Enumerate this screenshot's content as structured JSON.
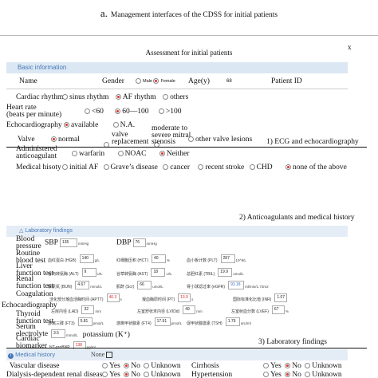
{
  "figure_title": {
    "letter": "a.",
    "text": "Management interfaces of the CDSS for initial patients"
  },
  "dialog": {
    "title": "Assessment for initial patients",
    "close": "x"
  },
  "basic": {
    "title": "Basic information",
    "name_label": "Name",
    "gender_label": "Gender",
    "gender_options": [
      "Male",
      "Female"
    ],
    "age_label": "Age(y)",
    "age_value": "68",
    "patient_id_label": "Patient ID",
    "cardiac_rhythm_label": "Cardiac rhythm",
    "rhythm_options": [
      "sinus rhythm",
      "AF rhythm",
      "others"
    ],
    "heart_rate_label": "Heart rate\n(beats per minute)",
    "heart_rate_options": [
      "<60",
      "60—100",
      ">100"
    ],
    "echo_label": "Echocardiography",
    "echo_options": [
      "available",
      "N.A."
    ],
    "valve_label": "Valve",
    "valve_options": [
      "normal",
      "valve\nreplacement",
      "moderate to\nsevere mitral\nstenosis",
      "other valve lesions"
    ],
    "section1_caption": "1) ECG and echocardiography",
    "anticoag_label": "Administered\nanticoagulant",
    "anticoag_options": [
      "warfarin",
      "NOAC",
      "Neither"
    ],
    "history_label": "Medical hisoty",
    "history_options": [
      "initial AF",
      "Grave’s disease",
      "cancer",
      "recent stroke",
      "CHD",
      "none of the above"
    ],
    "section2_caption": "2) Anticoagulants and medical history"
  },
  "lab": {
    "title": "Laboratory findings",
    "bp_label": "Blood\npressure",
    "sbp_label": "SBP",
    "sbp_value": "135",
    "dbp_label": "DBP",
    "dbp_value": "76",
    "bp_unit": "mmHg",
    "rbt_label": "Routine\nblood test",
    "rbt_items": [
      {
        "label": "血红蛋白 (HGB)",
        "value": "140",
        "unit": "g/L"
      },
      {
        "label": "红细胞压积 (HCT)",
        "value": "40",
        "unit": "%"
      },
      {
        "label": "血小板计数 (PLT)",
        "value": "287",
        "unit": "10^9/L"
      }
    ],
    "liver_label": "Liver\nfunction test",
    "liver_items": [
      {
        "label": "谷丙转氨酶 (ALT)",
        "value": "9",
        "unit": "U/L"
      },
      {
        "label": "谷草转氨酶 (AST)",
        "value": "18",
        "unit": "U/L"
      },
      {
        "label": "总胆红素 (TBIL)",
        "value": "19.9",
        "unit": "umol/L"
      }
    ],
    "renal_label": "Renal\nfunction test",
    "renal_items": [
      {
        "label": "尿素氮 (BUN)",
        "value": "4.67",
        "unit": "mmol/L"
      },
      {
        "label": "肌酐 (Scr)",
        "value": "66",
        "unit": "umol/L"
      },
      {
        "label": "肾小球滤过率 (eGFR)",
        "value": "93.18",
        "unit": "ml/min/1.73m2"
      }
    ],
    "coag_label": "Coagulation",
    "coag_items": [
      {
        "label": "活化部分凝血活酶时间 (APTT)",
        "value": "40.3",
        "unit": "s"
      },
      {
        "label": "凝血酶原时间 (PT)",
        "value": "13.9",
        "unit": "s"
      },
      {
        "label": "国际标准化比值 (INR)",
        "value": "1.07",
        "unit": ""
      }
    ],
    "echo_label": "Echocardiography",
    "echo_items": [
      {
        "label": "左房内径 (LAD)",
        "value": "32",
        "unit": "mm"
      },
      {
        "label": "左室舒张末内径 (LVIDd)",
        "value": "49",
        "unit": "mm"
      },
      {
        "label": "左室射血分数 (LVEF)",
        "value": "67",
        "unit": "%"
      }
    ],
    "thyroid_label": "Thyroid\nfunction test",
    "thyroid_items": [
      {
        "label": "游离三碟 (FT3)",
        "value": "5.81",
        "unit": "pmol/L"
      },
      {
        "label": "游离甲状腺素 (FT4)",
        "value": "17.91",
        "unit": "pmol/L"
      },
      {
        "label": "促甲状腺激素 (TSH)",
        "value": "1.79",
        "unit": "uIU/ml"
      }
    ],
    "serum_label": "Serum\nelectrolyte",
    "potassium_value": "3.5",
    "potassium_unit": "mmol/L",
    "potassium_label": "potassium (K⁺)",
    "biomarker_label": "Cardiac\nbiomarker",
    "bnp_label": "NT-proBNP",
    "bnp_value": "138",
    "bnp_unit": "pg/ml",
    "section3_caption": "3) Laboratory findings"
  },
  "medhist": {
    "title": "Medical history",
    "none_label": "None",
    "rows": [
      {
        "label": "Vascular disease",
        "options": [
          "Yes",
          "No",
          "Unknown"
        ],
        "right_label": "Cirrhosis",
        "right_options": [
          "Yes",
          "No",
          "Unknown"
        ]
      },
      {
        "label": "Dialysis-dependent renal disease",
        "options": [
          "Yes",
          "No",
          "Unknown"
        ],
        "right_label": "Hypertension",
        "right_options": [
          "Yes",
          "No",
          "Unknown"
        ]
      }
    ]
  },
  "colors": {
    "accent": "#4a78b8",
    "section_bg": "#dbe7f3",
    "selected": "#e0302a"
  }
}
